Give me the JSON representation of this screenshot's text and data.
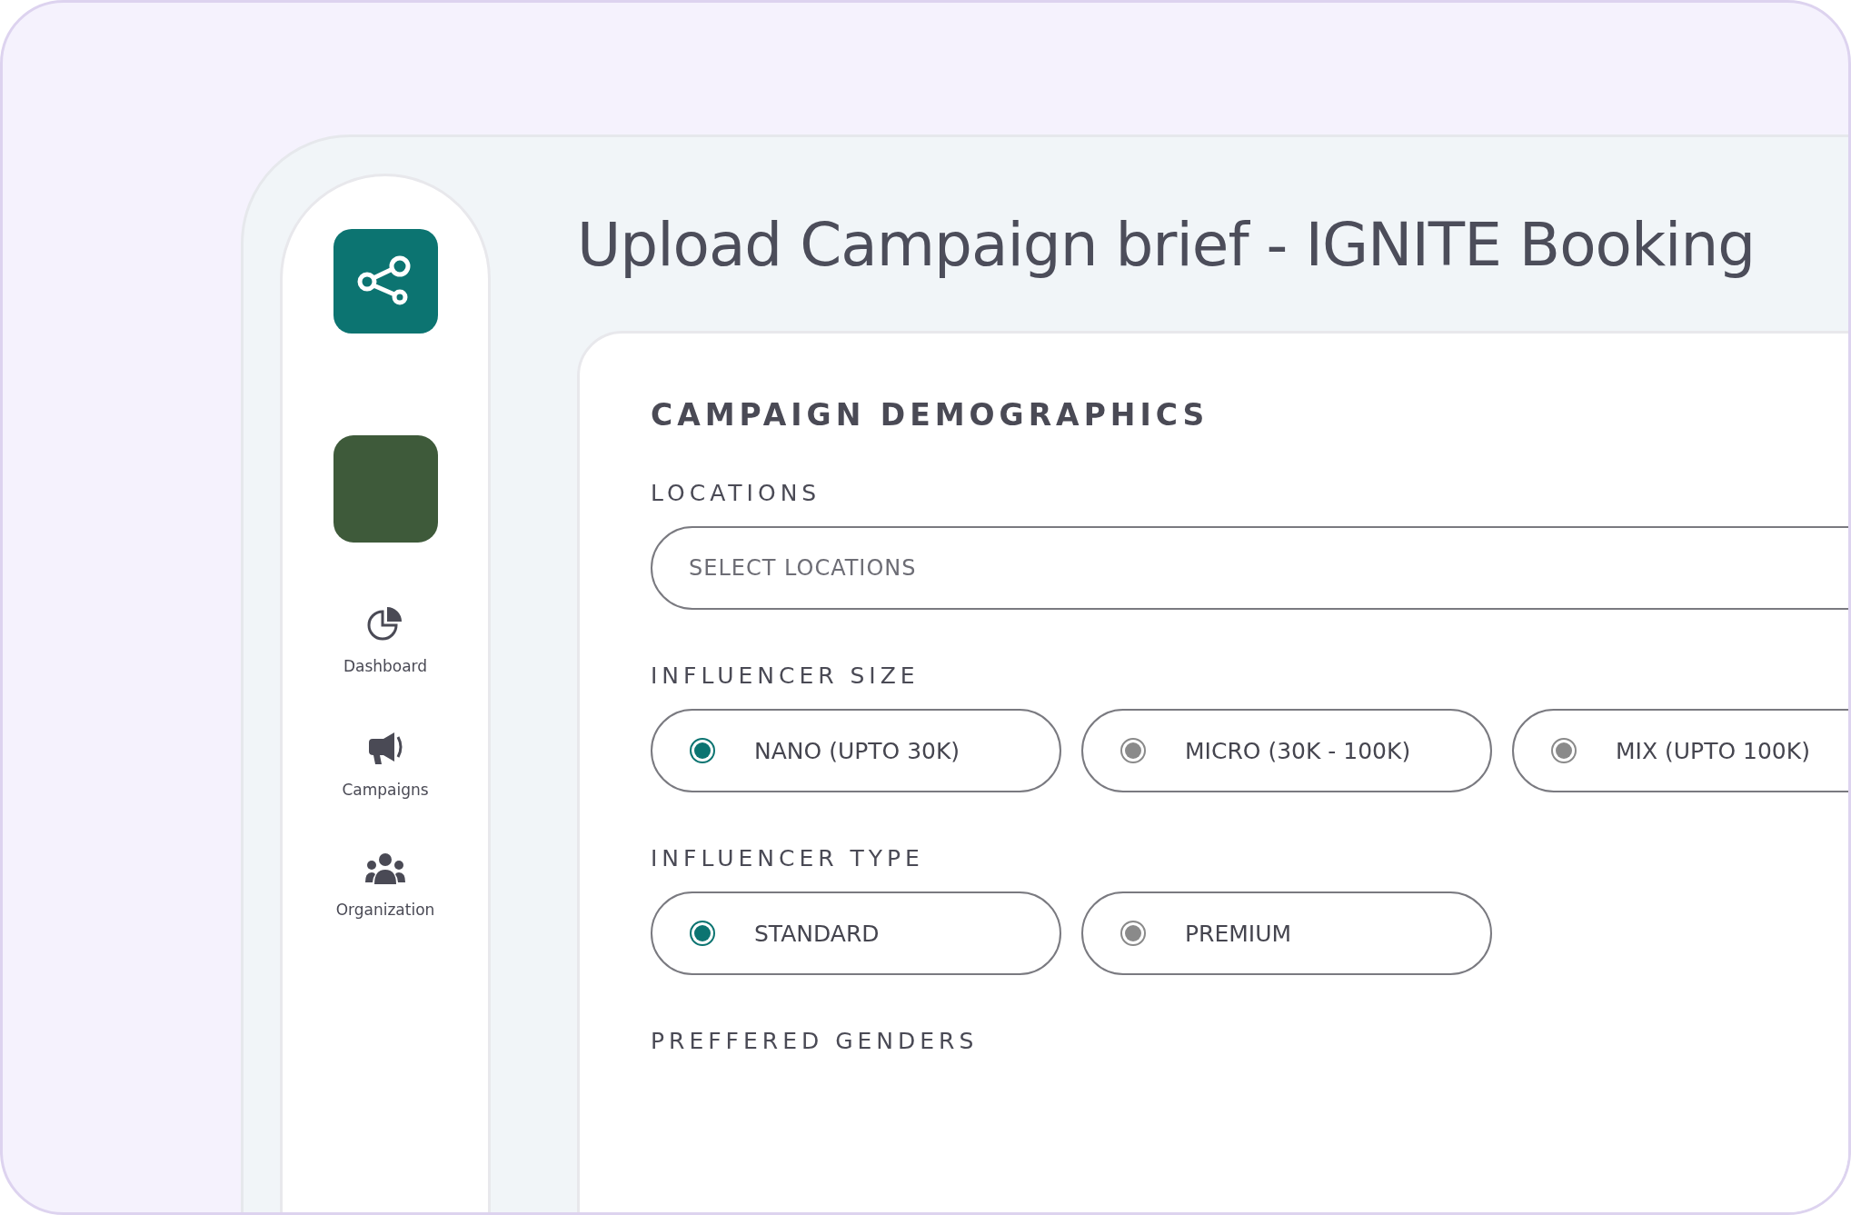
{
  "page": {
    "title": "Upload Campaign brief - IGNITE Booking"
  },
  "sidebar": {
    "items": [
      {
        "label": "Dashboard",
        "kind": "pie"
      },
      {
        "label": "Campaigns",
        "kind": "megaphone"
      },
      {
        "label": "Organization",
        "kind": "people"
      }
    ]
  },
  "card": {
    "heading": "CAMPAIGN DEMOGRAPHICS",
    "locations": {
      "label": "LOCATIONS",
      "placeholder": "SELECT LOCATIONS"
    },
    "influencer_size": {
      "label": "INFLUENCER SIZE",
      "options": [
        {
          "label": "NANO (UPTO 30K)",
          "selected": true
        },
        {
          "label": "MICRO (30K - 100K)",
          "selected": false
        },
        {
          "label": "MIX (UPTO 100K)",
          "selected": false
        }
      ]
    },
    "influencer_type": {
      "label": "INFLUENCER TYPE",
      "options": [
        {
          "label": "STANDARD",
          "selected": true
        },
        {
          "label": "PREMIUM",
          "selected": false
        }
      ]
    },
    "preferred_genders": {
      "label": "PREFFERED GENDERS"
    }
  }
}
